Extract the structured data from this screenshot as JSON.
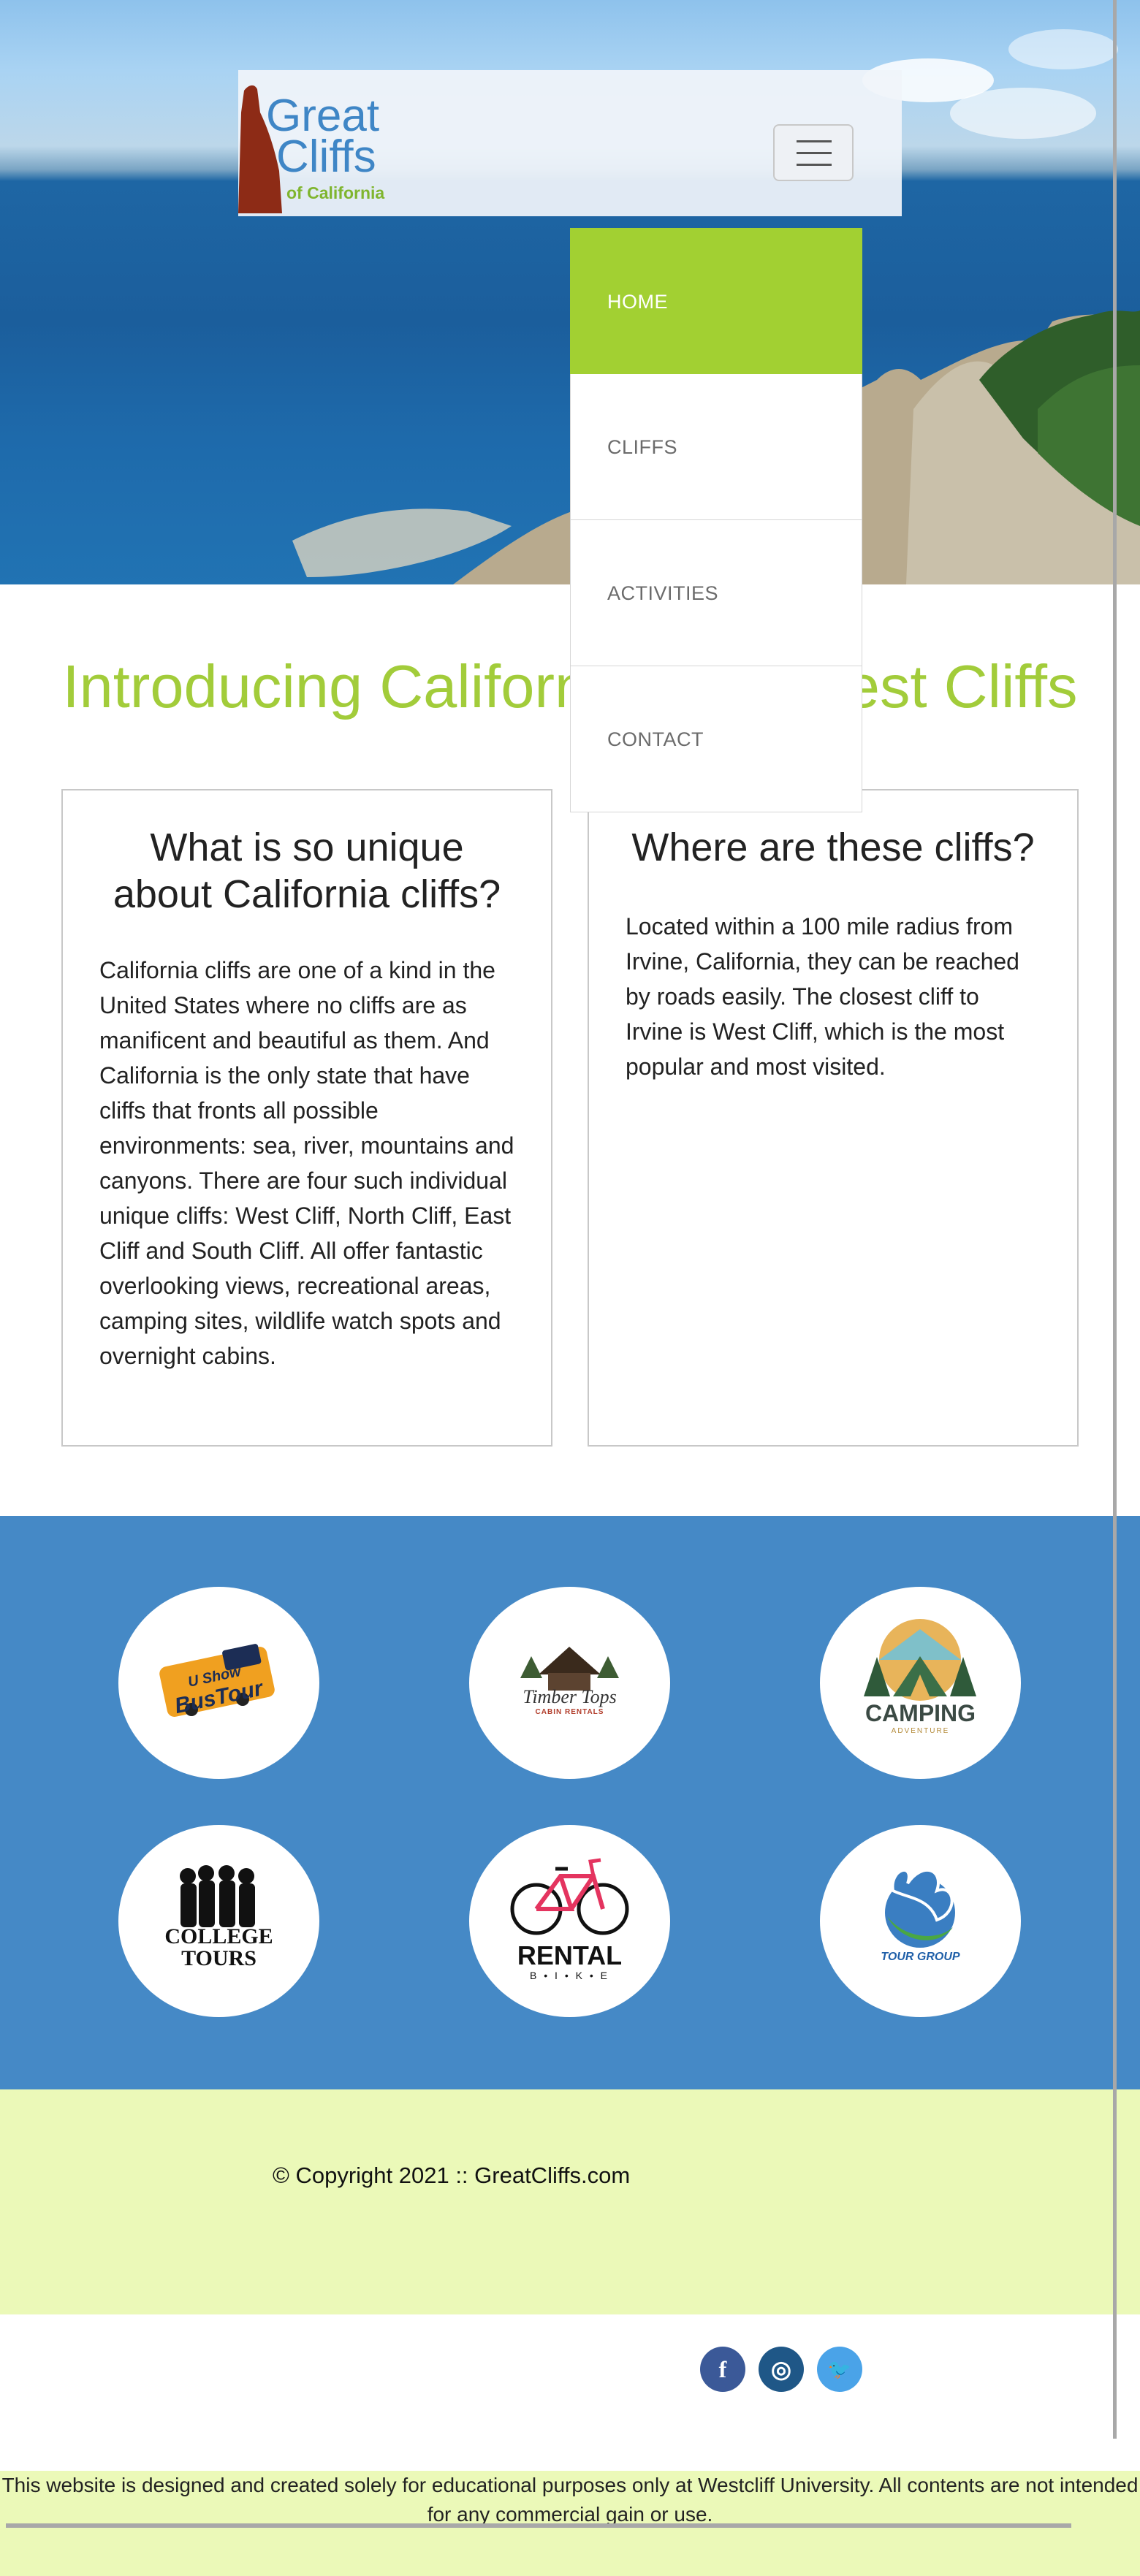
{
  "logo": {
    "line1": "Great",
    "line2": "Cliffs",
    "line3": "of California"
  },
  "nav": {
    "toggle_icon": "hamburger-menu-icon",
    "items": [
      {
        "label": "HOME",
        "active": true
      },
      {
        "label": "CLIFFS",
        "active": false
      },
      {
        "label": "ACTIVITIES",
        "active": false
      },
      {
        "label": "CONTACT",
        "active": false
      }
    ]
  },
  "intro": {
    "title": "Introducing California's Greatest Cliffs"
  },
  "cards": [
    {
      "heading": "What is so unique about California cliffs?",
      "body": "California cliffs are one of a kind in the United States where no cliffs are as manificent and beautiful as them. And California is the only state that have cliffs that fronts all possible environments: sea, river, mountains and canyons. There are four such individual unique cliffs: West Cliff, North Cliff, East Cliff and South Cliff. All offer fantastic overlooking views, recreational areas, camping sites, wildlife watch spots and overnight cabins."
    },
    {
      "heading": "Where are these cliffs?",
      "body": "Located within a 100 mile radius from Irvine, California, they can be reached by roads easily. The closest cliff to Irvine is West Cliff, which is the most popular and most visited."
    }
  ],
  "partners": [
    {
      "line1": "U Show",
      "line2": "BusTour",
      "icon": "bus-tour-logo"
    },
    {
      "line1": "Timber Tops",
      "line2": "CABIN RENTALS",
      "icon": "cabin-logo"
    },
    {
      "line1": "CAMPING",
      "line2": "ADVENTURE",
      "icon": "camping-tent-logo"
    },
    {
      "line1": "COLLEGE",
      "line2": "TOURS",
      "icon": "college-tours-logo"
    },
    {
      "line1": "RENTAL",
      "line2": "B • I • K • E",
      "icon": "bicycle-logo"
    },
    {
      "line1": "TOUR GROUP",
      "line2": "",
      "icon": "tour-group-logo"
    }
  ],
  "footer": {
    "copyright": "© Copyright 2021 :: GreatCliffs.com",
    "social": [
      {
        "icon": "facebook-icon",
        "glyph": "f",
        "color": "#3b5998"
      },
      {
        "icon": "instagram-icon",
        "glyph": "◎",
        "color": "#1f5787"
      },
      {
        "icon": "twitter-icon",
        "glyph": "🐦",
        "color": "#4aa3e8"
      }
    ],
    "disclaimer": "This website is designed and created solely for educational purposes only at Westcliff University. All contents are not intended for any commercial gain or use."
  },
  "colors": {
    "accent_green": "#a2d032",
    "brand_blue": "#3f86c6",
    "partners_bg": "#4589c6",
    "footer_bg": "#ebf9b8"
  }
}
